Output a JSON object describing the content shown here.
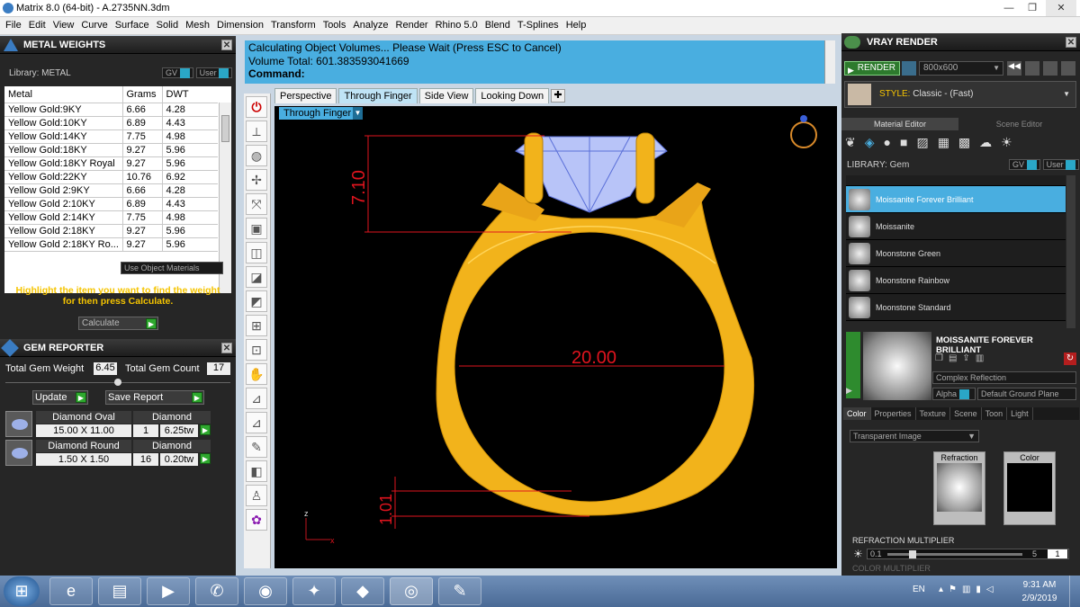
{
  "window": {
    "title": "Matrix 8.0 (64-bit) - A.2735NN.3dm"
  },
  "menu": [
    "File",
    "Edit",
    "View",
    "Curve",
    "Surface",
    "Solid",
    "Mesh",
    "Dimension",
    "Transform",
    "Tools",
    "Analyze",
    "Render",
    "Rhino 5.0",
    "Blend",
    "T-Splines",
    "Help"
  ],
  "metal_weights": {
    "title": "METAL WEIGHTS",
    "library_label": "Library: METAL",
    "gv_label": "GV",
    "user_label": "User",
    "columns": [
      "Metal",
      "Grams",
      "DWT"
    ],
    "rows": [
      [
        "Yellow Gold:9KY",
        "6.66",
        "4.28"
      ],
      [
        "Yellow Gold:10KY",
        "6.89",
        "4.43"
      ],
      [
        "Yellow Gold:14KY",
        "7.75",
        "4.98"
      ],
      [
        "Yellow Gold:18KY",
        "9.27",
        "5.96"
      ],
      [
        "Yellow Gold:18KY Royal",
        "9.27",
        "5.96"
      ],
      [
        "Yellow Gold:22KY",
        "10.76",
        "6.92"
      ],
      [
        "Yellow Gold 2:9KY",
        "6.66",
        "4.28"
      ],
      [
        "Yellow Gold 2:10KY",
        "6.89",
        "4.43"
      ],
      [
        "Yellow Gold 2:14KY",
        "7.75",
        "4.98"
      ],
      [
        "Yellow Gold 2:18KY",
        "9.27",
        "5.96"
      ],
      [
        "Yellow Gold 2:18KY Ro...",
        "9.27",
        "5.96"
      ]
    ],
    "use_object_materials": "Use Object Materials",
    "hint": "Highlight the item you want to find the weight for then press Calculate.",
    "calculate": "Calculate"
  },
  "gem_reporter": {
    "title": "GEM REPORTER",
    "total_weight_label": "Total Gem Weight",
    "total_weight": "6.45",
    "total_count_label": "Total Gem Count",
    "total_count": "17",
    "update": "Update",
    "save_report": "Save Report",
    "gems": [
      {
        "shape": "Diamond Oval",
        "material": "Diamond",
        "size": "15.00 X 11.00",
        "count": "1",
        "tw": "6.25tw"
      },
      {
        "shape": "Diamond Round",
        "material": "Diamond",
        "size": "1.50 X 1.50",
        "count": "16",
        "tw": "0.20tw"
      }
    ]
  },
  "command": {
    "line1": "Calculating Object Volumes... Please Wait (Press ESC to Cancel)",
    "line2": "Volume Total: 601.383593041669",
    "prompt": "Command:"
  },
  "viewport": {
    "tabs": [
      "Perspective",
      "Through Finger",
      "Side View",
      "Looking Down"
    ],
    "active_tab": "Through Finger",
    "label": "Through Finger",
    "dims": {
      "top": "7.10",
      "width": "20.00",
      "bottom": "1.01"
    },
    "axis_z": "z",
    "axis_x": "x",
    "colors": {
      "gold": "#f2b31b",
      "dim": "#e0141e",
      "bg": "#000000"
    }
  },
  "vray": {
    "title": "VRAY RENDER",
    "render": "RENDER",
    "resolution": "800x600",
    "style_label": "STYLE:",
    "style_value": "Classic - (Fast)",
    "tabs": [
      "Material Editor",
      "Scene Editor"
    ],
    "library_label": "LIBRARY: Gem",
    "gv_label": "GV",
    "user_label": "User",
    "materials": [
      "Moissanite Forever Brilliant",
      "Moissanite",
      "Moonstone Green",
      "Moonstone Rainbow",
      "Moonstone Standard"
    ],
    "selected_material": "Moissanite Forever Brilliant",
    "material_name": "MOISSANITE FOREVER BRILLIANT",
    "reflection": "Complex Reflection",
    "alpha_label": "Alpha",
    "ground": "Default Ground Plane",
    "prop_tabs": [
      "Color",
      "Properties",
      "Texture",
      "Scene",
      "Toon",
      "Light"
    ],
    "transparent": "Transparent Image",
    "refraction_label": "Refraction",
    "color_label": "Color",
    "refraction_multiplier": "REFRACTION MULTIPLIER",
    "mult_min": "0.1",
    "mult_max": "5",
    "mult_val": "1",
    "color_multiplier": "COLOR MULTIPLIER"
  },
  "taskbar": {
    "lang": "EN",
    "time": "9:31 AM",
    "date": "2/9/2019"
  }
}
